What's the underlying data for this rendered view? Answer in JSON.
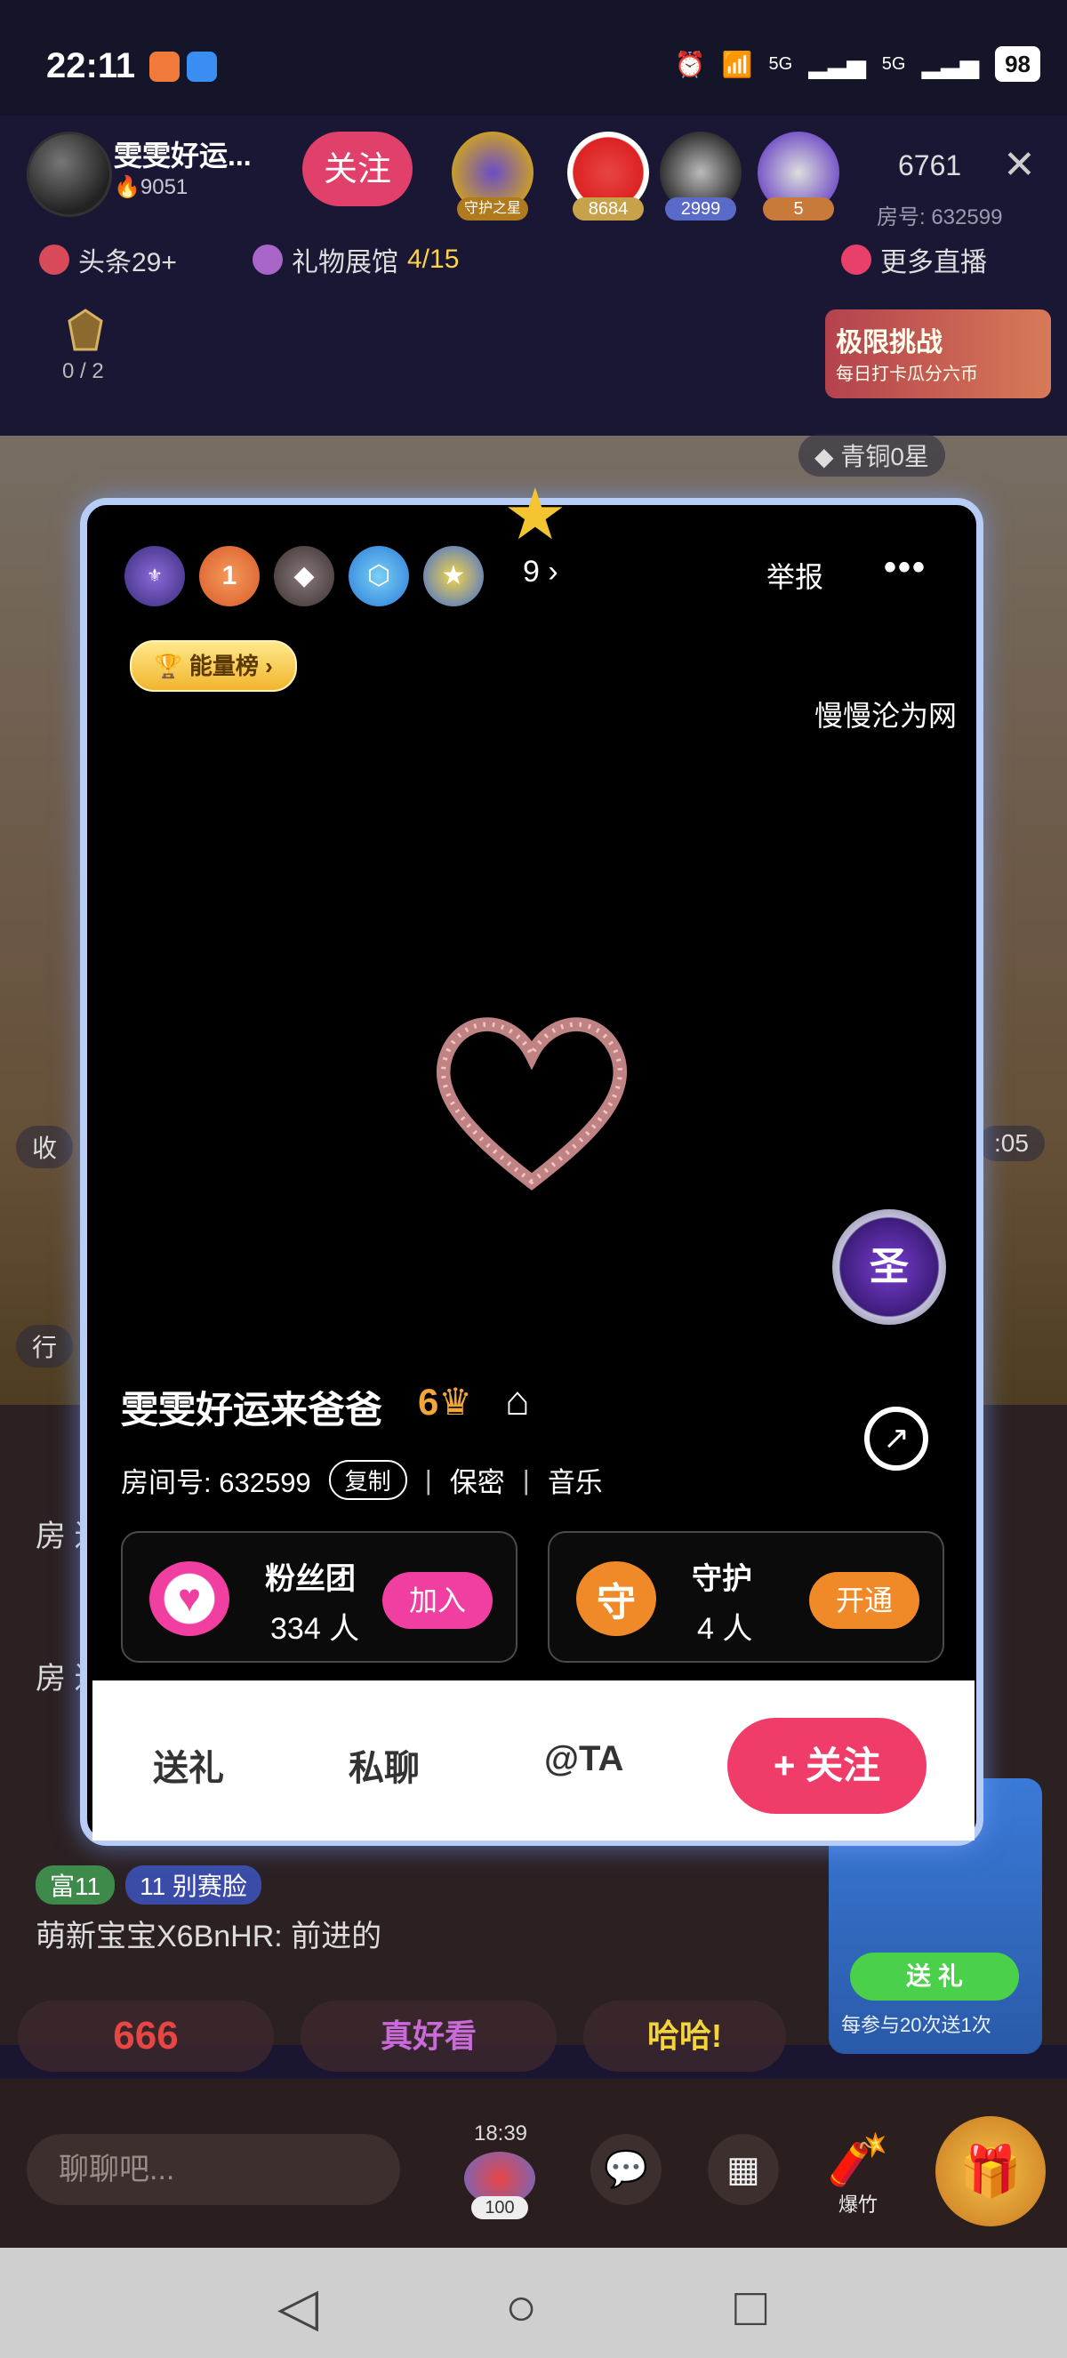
{
  "status_bar": {
    "time": "22:11",
    "battery": "98",
    "signal_labels": [
      "5G",
      "5G"
    ]
  },
  "header": {
    "host_name": "雯雯好运...",
    "host_hot": "9051",
    "follow_label": "关注",
    "viewer_badges": [
      "守护之星",
      "8684",
      "2999",
      "5"
    ],
    "viewer_count": "6761",
    "room_number_label": "房号: 632599",
    "headline_label": "头条29+",
    "gift_hall_label": "礼物展馆",
    "gift_hall_progress": "4/15",
    "more_live_label": "更多直播",
    "rank_progress": "0 / 2",
    "challenge_title": "极限挑战",
    "challenge_sub": "每日打卡瓜分六币",
    "bronze_label": "青铜0星"
  },
  "scene": {
    "left_pill_1": "收",
    "left_pill_2": "行",
    "right_pill": ":05"
  },
  "chat": {
    "lines": [
      "房 进",
      "房 进",
      "萌新宝宝X6BnHR: 前进的"
    ],
    "badges": [
      "富11",
      "11 别赛脸"
    ],
    "quick_phrases": [
      "666",
      "真好看",
      "哈哈!"
    ],
    "timer": "18:39",
    "gift_count_badge": "100",
    "input_placeholder": "聊聊吧...",
    "firecracker_label": "爆竹",
    "send_gift_label": "送 礼",
    "promo_text": "每参与20次送1次"
  },
  "card": {
    "medal_count": "9",
    "report_label": "举报",
    "energy_label": "能量榜 ›",
    "marquee": "慢慢沦为网",
    "name": "雯雯好运来爸爸",
    "level": "6",
    "room_label": "房间号: 632599",
    "copy_label": "复制",
    "privacy_label": "保密",
    "music_label": "音乐",
    "fans": {
      "title": "粉丝团",
      "count": "334 人",
      "button": "加入"
    },
    "guard": {
      "title": "守护",
      "count": "4 人",
      "button": "开通",
      "icon_char": "守"
    },
    "actions": {
      "gift": "送礼",
      "chat": "私聊",
      "at": "@TA",
      "follow": "+ 关注"
    },
    "saint_char": "圣"
  },
  "colors": {
    "follow_pink": "#ef3c68",
    "gold": "#f4c531",
    "fans_pink": "#f03fa0",
    "guard_orange": "#f08a28"
  }
}
